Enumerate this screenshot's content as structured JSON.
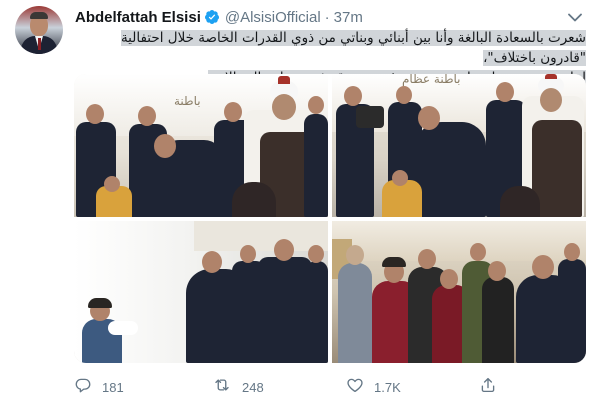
{
  "tweet": {
    "author_name": "Abdelfattah Elsisi",
    "handle": "@AlsisiOfficial",
    "separator": "·",
    "time": "37m",
    "text_line1": "شعرت بالسعادة البالغة وأنا بين أبنائي وبناتي من ذوي القدرات الخاصة خلال احتفالية \"قادرون باختلاف\"،",
    "text_line2": "لما حققوه من نتائج باهرة عديدة وغير مسبوقة في مختلف المجالات.",
    "photo_sign_1": "باطنة",
    "photo_sign_2": "باطنة عظام"
  },
  "actions": {
    "reply_count": "181",
    "retweet_count": "248",
    "like_count": "1.7K"
  },
  "colors": {
    "accent": "#1da1f2",
    "icon_gray": "#657786",
    "text": "#14171a",
    "highlight": "#d1d5d9"
  },
  "icons": {
    "verified": "verified-badge-icon",
    "caret": "chevron-down-icon",
    "reply": "reply-icon",
    "retweet": "retweet-icon",
    "like": "heart-icon",
    "share": "share-icon"
  }
}
